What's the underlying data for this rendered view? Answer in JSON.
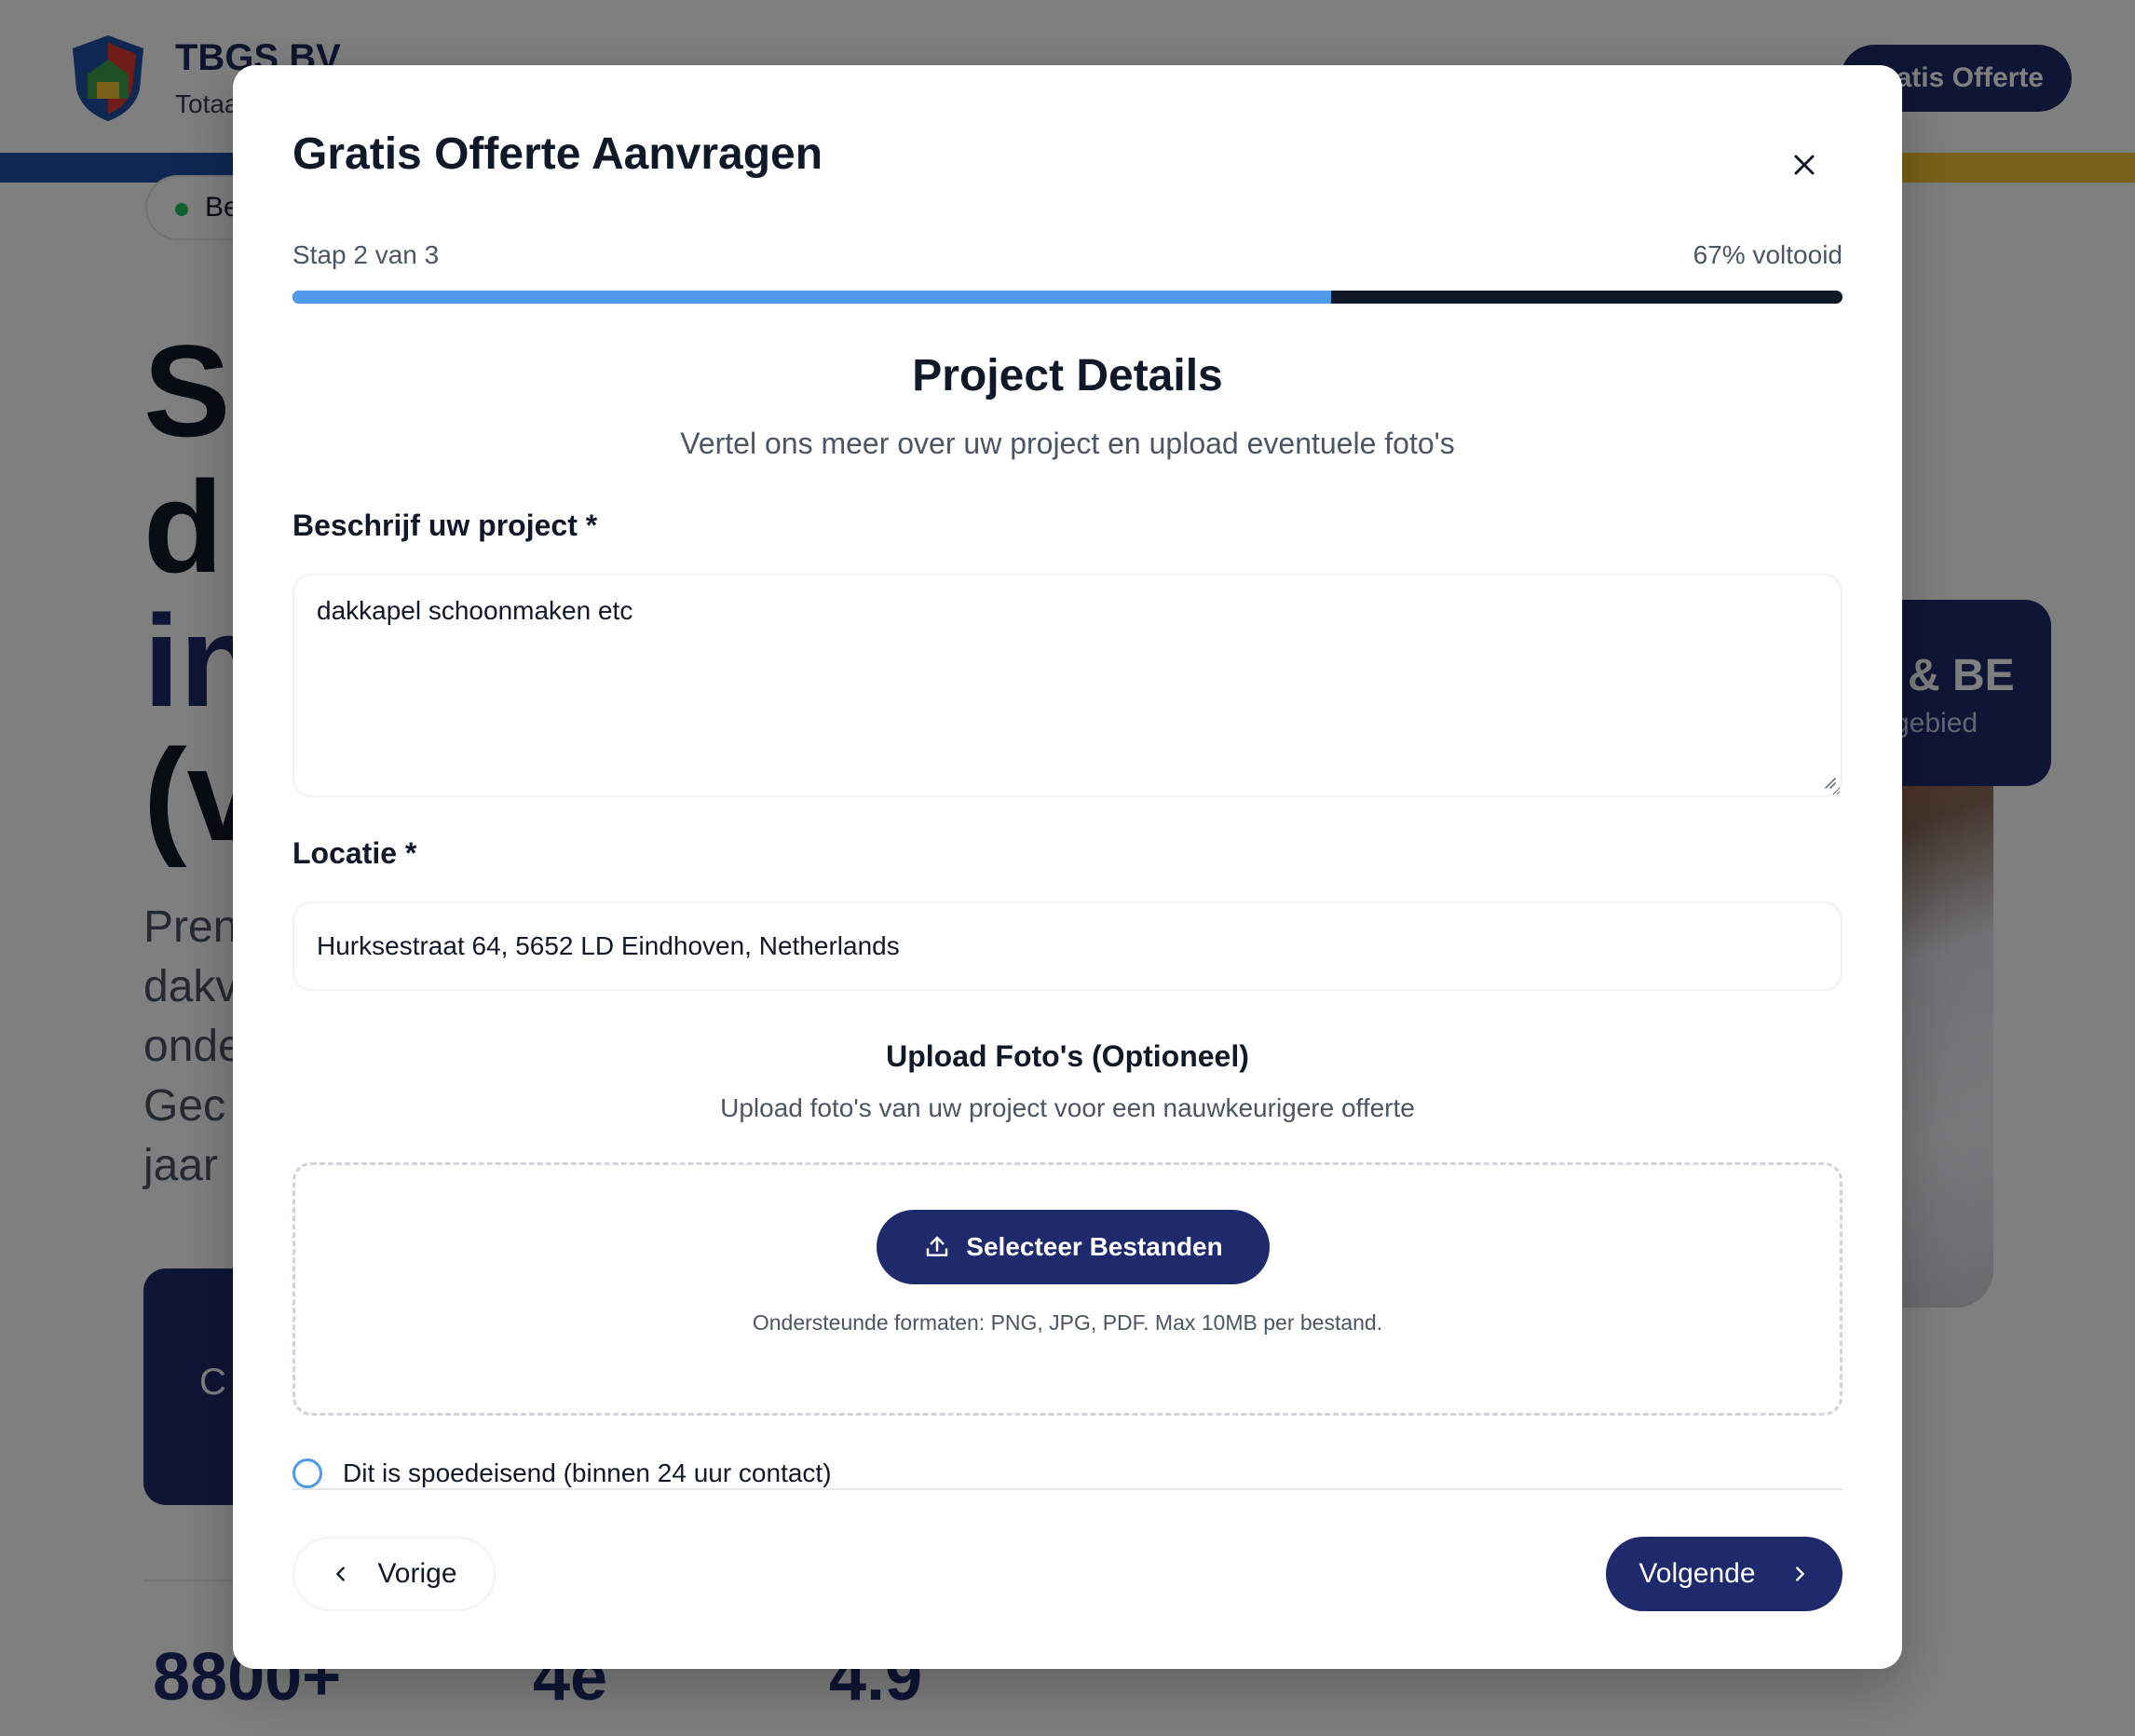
{
  "background": {
    "brand": "TBGS BV",
    "tagline": "Totaa",
    "cta": "atis Offerte",
    "badge": "Be",
    "hero_lines": [
      "S",
      "d",
      "in",
      "(v"
    ],
    "paragraph_lines": [
      "Pren",
      "dakv",
      "onde",
      "Gec",
      "jaar"
    ],
    "card_title": "& BE",
    "card_sub": "kgebied",
    "dark_card_text": "C",
    "stats": [
      "8800+",
      "4e",
      "4.9"
    ],
    "colors": {
      "navy": "#1e2a6b",
      "stripe_blue": "#1e4fa3",
      "stripe_yellow": "#f2c230"
    }
  },
  "modal": {
    "title": "Gratis Offerte Aanvragen",
    "close_icon": "close-icon",
    "step_text": "Stap 2 van 3",
    "progress_text": "67% voltooid",
    "progress_fraction": 0.67,
    "section_title": "Project Details",
    "section_subtitle": "Vertel ons meer over uw project en upload eventuele foto's",
    "description": {
      "label": "Beschrijf uw project *",
      "value": "dakkapel schoonmaken etc"
    },
    "location": {
      "label": "Locatie *",
      "value": "Hurksestraat 64, 5652 LD Eindhoven, Netherlands"
    },
    "upload": {
      "title": "Upload Foto's (Optioneel)",
      "subtitle": "Upload foto's van uw project voor een nauwkeurigere offerte",
      "button_label": "Selecteer Bestanden",
      "button_icon": "upload-icon",
      "formats": "Ondersteunde formaten: PNG, JPG, PDF. Max 10MB per bestand."
    },
    "urgent": {
      "label": "Dit is spoedeisend (binnen 24 uur contact)",
      "checked": false
    },
    "prev_label": "Vorige",
    "next_label": "Volgende",
    "colors": {
      "accent": "#4f9ae8",
      "primary": "#1e2a6b"
    }
  }
}
